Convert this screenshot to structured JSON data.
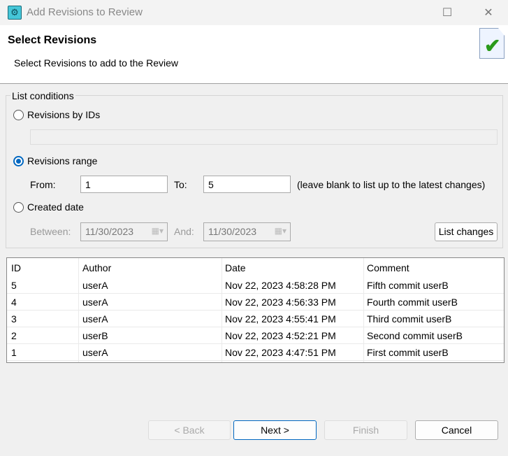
{
  "window": {
    "title": "Add Revisions to Review",
    "minimize": "—",
    "maximize": "☐",
    "close": "✕"
  },
  "header": {
    "title": "Select Revisions",
    "subtitle": "Select Revisions to add to the Review"
  },
  "conditions": {
    "group_label": "List conditions",
    "by_ids_label": "Revisions by IDs",
    "ids_value": "",
    "range_label": "Revisions range",
    "range_selected": true,
    "from_label": "From:",
    "from_value": "1",
    "to_label": "To:",
    "to_value": "5",
    "range_hint": "(leave blank to list up to the latest changes)",
    "date_label": "Created date",
    "between_label": "Between:",
    "between_value": "11/30/2023",
    "and_label": "And:",
    "and_value": "11/30/2023",
    "list_changes": "List changes"
  },
  "table": {
    "columns": [
      "ID",
      "Author",
      "Date",
      "Comment"
    ],
    "rows": [
      [
        "5",
        "userA",
        "Nov 22, 2023 4:58:28 PM",
        "Fifth commit userB"
      ],
      [
        "4",
        "userA",
        "Nov 22, 2023 4:56:33 PM",
        "Fourth commit userB"
      ],
      [
        "3",
        "userA",
        "Nov 22, 2023 4:55:41 PM",
        "Third commit userB"
      ],
      [
        "2",
        "userB",
        "Nov 22, 2023 4:52:21 PM",
        "Second commit userB"
      ],
      [
        "1",
        "userA",
        "Nov 22, 2023 4:47:51 PM",
        "First commit userB"
      ]
    ]
  },
  "buttons": {
    "back": "< Back",
    "next": "Next >",
    "finish": "Finish",
    "cancel": "Cancel"
  }
}
